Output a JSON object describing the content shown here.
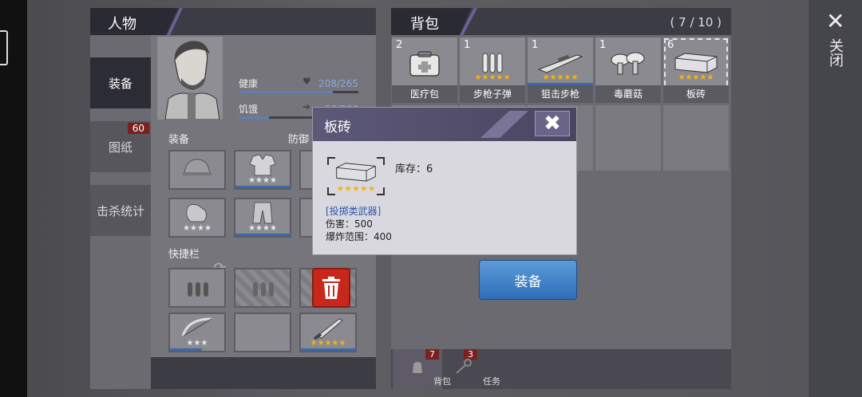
{
  "character_panel": {
    "title": "人物",
    "tabs": [
      {
        "label": "装备",
        "active": true
      },
      {
        "label": "图纸",
        "badge": "60"
      },
      {
        "label": "击杀统计"
      }
    ],
    "stats": {
      "health_label": "健康",
      "health_value": "208/265",
      "health_fraction": 0.785,
      "hunger_label": "饥饿",
      "hunger_value": "50/200",
      "hunger_fraction": 0.25
    },
    "equipment_label": "装备",
    "defense_label": "防御",
    "quickbar_label": "快捷栏",
    "slot_stars": "★★★★",
    "slot_stars_3": "★★★",
    "slot_stars_gold": "★★★★★"
  },
  "bag_panel": {
    "title": "背包",
    "count": "( 7 / 10 )",
    "items": [
      {
        "qty": "2",
        "label": "医疗包",
        "icon": "medkit-icon"
      },
      {
        "qty": "1",
        "label": "步枪子弹",
        "icon": "ammo-icon",
        "stars": "★★★★★"
      },
      {
        "qty": "1",
        "label": "狙击步枪",
        "icon": "sniper-rifle-icon",
        "stars": "★★★★★"
      },
      {
        "qty": "1",
        "label": "毒蘑菇",
        "icon": "mushroom-icon"
      },
      {
        "qty": "6",
        "label": "板砖",
        "icon": "brick-icon",
        "stars": "★★★★★",
        "selected": true
      }
    ],
    "footer_tabs": [
      {
        "label": "背包",
        "badge": "7",
        "icon": "backpack-icon"
      },
      {
        "label": "任务",
        "badge": "3",
        "icon": "key-icon"
      }
    ]
  },
  "close": {
    "label": "关闭",
    "icon": "close-icon"
  },
  "popup": {
    "title": "板砖",
    "stock": "库存：6",
    "stars": "★★★★★",
    "category": "[投掷类武器]",
    "damage": "伤害：500",
    "range": "爆炸范围：400"
  },
  "equip_button": "装备",
  "colors": {
    "accent_purple": "#6d5f9a",
    "button_blue": "#2e6eb8",
    "star_gold": "#f2b11d",
    "badge_red": "#7a2020"
  }
}
